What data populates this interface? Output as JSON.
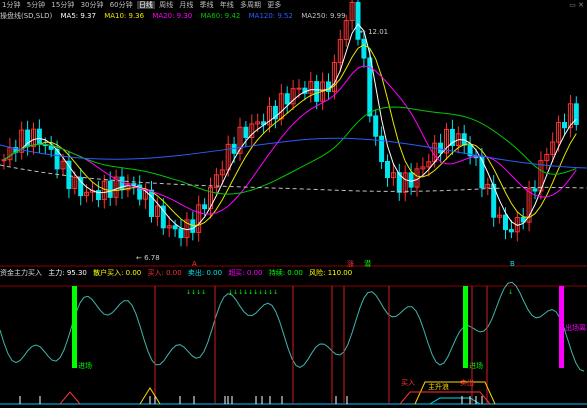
{
  "toolbar": {
    "items": [
      "1分钟",
      "5分钟",
      "15分钟",
      "30分钟",
      "60分钟",
      "日线",
      "周线",
      "月线",
      "季线",
      "年线",
      "多周期",
      "更多"
    ],
    "active_index": 5
  },
  "main_legend": {
    "title": "操盘线(SD,SLD)",
    "ma5": "MA5: 9.37",
    "ma10": "MA10: 9.36",
    "ma20": "MA20: 9.30",
    "ma60": "MA60: 9.42",
    "ma120": "MA120: 9.52",
    "ma250": "MA250: 9.99"
  },
  "annotations": {
    "high_price": "12.01",
    "low_price": "6.78",
    "label_a": "A",
    "label_buy1": "涨",
    "label_buy2": "潜",
    "label_mark": "B"
  },
  "indicator_legend": {
    "title": "资金主力买入",
    "v1": "主力: 95.30",
    "v2": "散户买入: 0.00",
    "v3": "买入: 0.00",
    "v4": "卖出: 0.00",
    "v5": "超买: 0.00",
    "v6": "持续: 0.00",
    "v7": "风险: 110.00"
  },
  "indicator_labels": {
    "left_bar": "进场",
    "mid_bar": "进场",
    "right_bar": "出场离场",
    "band1": "买入",
    "band2": "主升浪",
    "band3": "卖出"
  },
  "colors": {
    "up": "#ff3232",
    "down": "#00e5ee",
    "ma5": "#ffffff",
    "ma10": "#e8e800",
    "ma20": "#ff00ff",
    "ma60": "#00c800",
    "ma120": "#2a5cff",
    "ma250": "#c0c0c0"
  }
}
